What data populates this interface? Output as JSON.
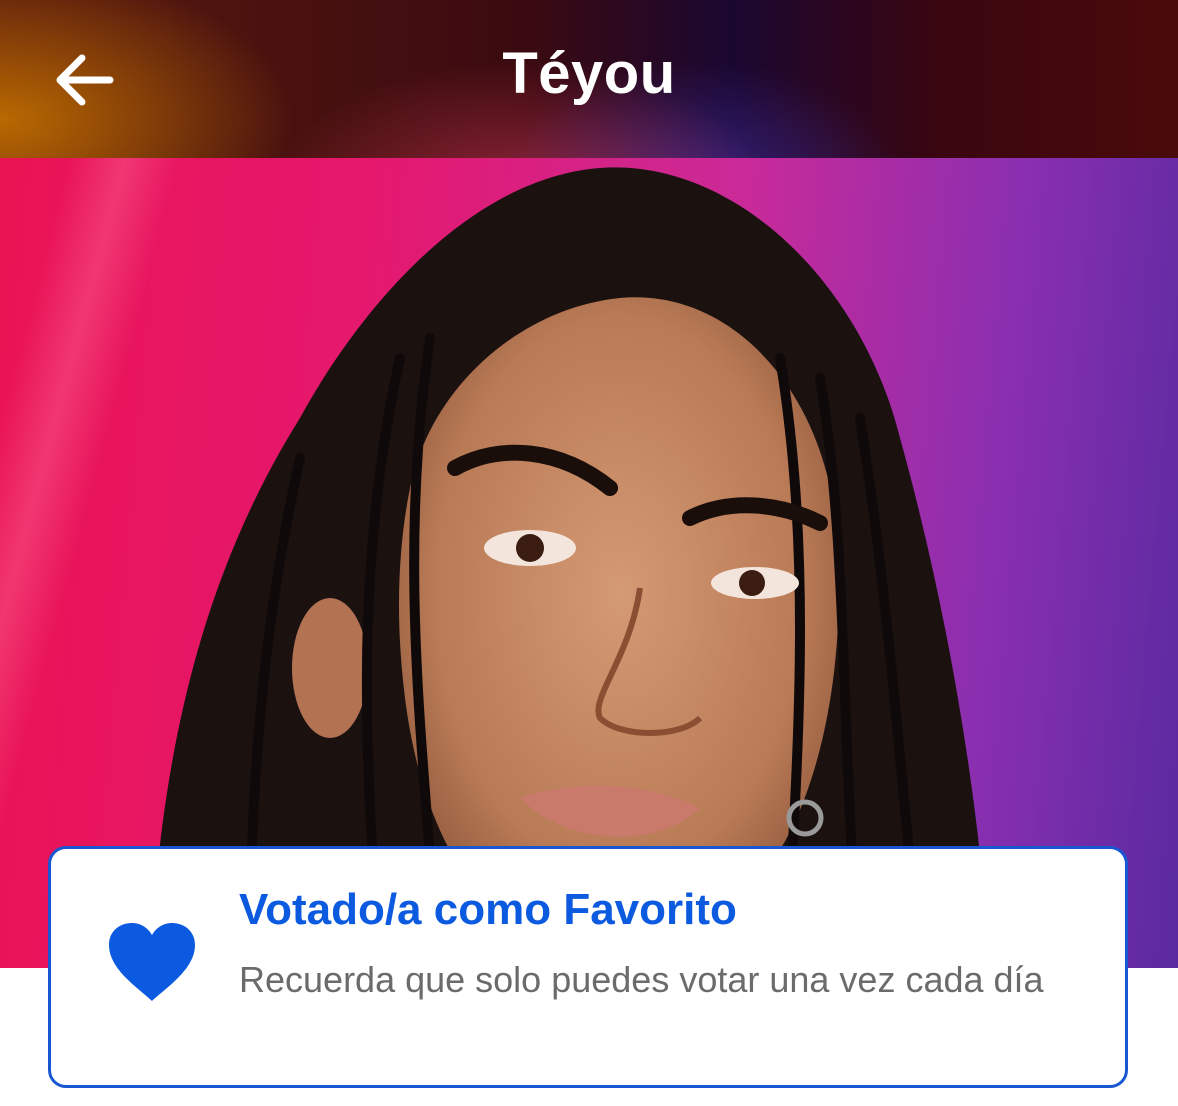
{
  "header": {
    "title": "Téyou",
    "back_icon": "arrow-left-icon"
  },
  "hero": {
    "image": "contestant-portrait"
  },
  "toast": {
    "icon": "heart-icon",
    "accent_color": "#0b5ae0",
    "title": "Votado/a como Favorito",
    "message": "Recuerda que solo puedes votar una vez cada día"
  }
}
